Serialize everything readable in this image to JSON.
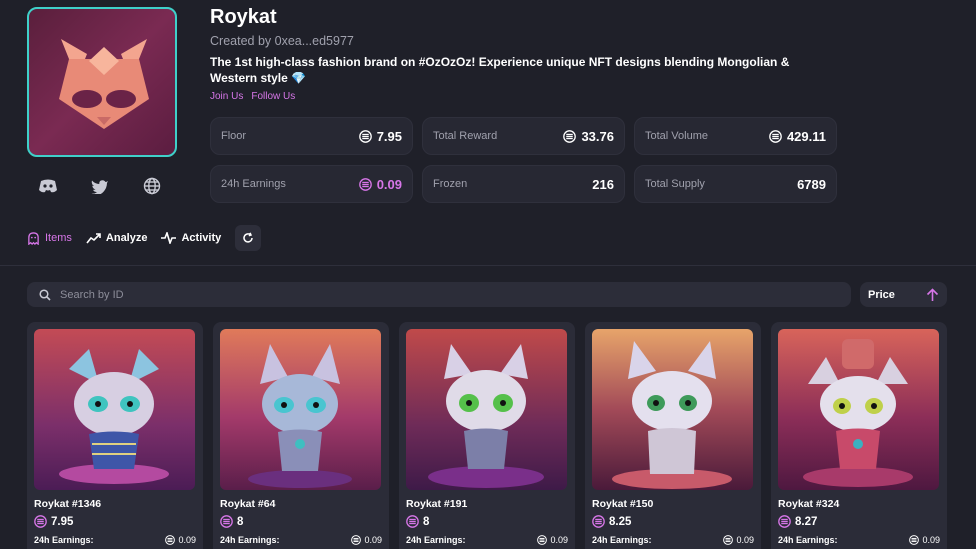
{
  "collection": {
    "name": "Roykat",
    "creator": "Created by 0xea...ed5977",
    "description": "The 1st high-class fashion brand on #OzOzOz! Experience unique NFT designs blending Mongolian & Western style 💎",
    "join_label": "Join Us",
    "follow_label": "Follow Us"
  },
  "socials": [
    "discord-icon",
    "twitter-icon",
    "globe-icon"
  ],
  "stats": {
    "floor": {
      "label": "Floor",
      "value": "7.95"
    },
    "total_reward": {
      "label": "Total Reward",
      "value": "33.76"
    },
    "total_volume": {
      "label": "Total Volume",
      "value": "429.11"
    },
    "earnings_24h": {
      "label": "24h Earnings",
      "value": "0.09"
    },
    "frozen": {
      "label": "Frozen",
      "value": "216"
    },
    "total_supply": {
      "label": "Total Supply",
      "value": "6789"
    }
  },
  "tabs": {
    "items": "Items",
    "analyze": "Analyze",
    "activity": "Activity"
  },
  "search": {
    "placeholder": "Search by ID"
  },
  "sort": {
    "label": "Price"
  },
  "cards": [
    {
      "name": "Roykat #1346",
      "price": "7.95",
      "earn_label": "24h Earnings:",
      "earn": "0.09"
    },
    {
      "name": "Roykat #64",
      "price": "8",
      "earn_label": "24h Earnings:",
      "earn": "0.09"
    },
    {
      "name": "Roykat #191",
      "price": "8",
      "earn_label": "24h Earnings:",
      "earn": "0.09"
    },
    {
      "name": "Roykat #150",
      "price": "8.25",
      "earn_label": "24h Earnings:",
      "earn": "0.09"
    },
    {
      "name": "Roykat #324",
      "price": "8.27",
      "earn_label": "24h Earnings:",
      "earn": "0.09"
    }
  ],
  "colors": {
    "accent": "#d776e8",
    "background": "#1f2029",
    "panel": "#272833",
    "logo_border": "#3fd0c9"
  }
}
